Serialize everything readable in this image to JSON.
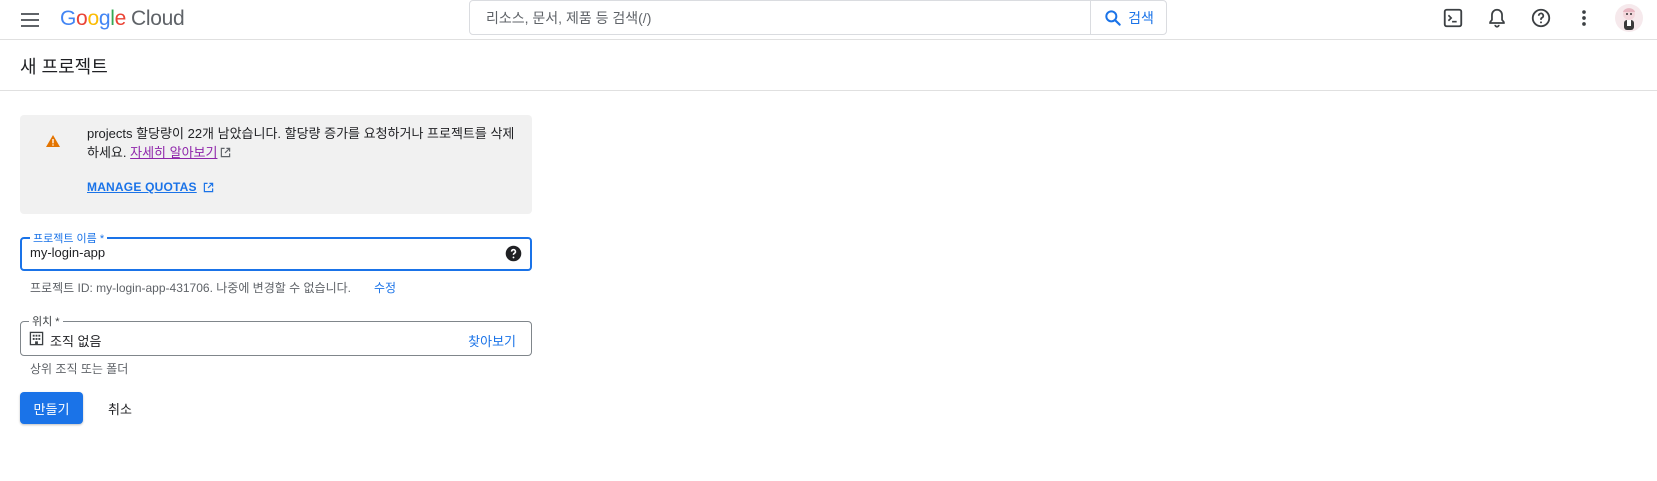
{
  "header": {
    "logo": {
      "G": "G",
      "o1": "o",
      "o2": "o",
      "g": "g",
      "l": "l",
      "e": "e",
      "cloud": "Cloud"
    },
    "search": {
      "placeholder": "리소스, 문서, 제품 등 검색(/)",
      "button_label": "검색"
    },
    "icons": [
      "menu-icon",
      "cloud-shell-icon",
      "notifications-icon",
      "help-icon",
      "more-vert-icon",
      "avatar"
    ]
  },
  "page": {
    "title": "새 프로젝트"
  },
  "warning": {
    "text": "projects 할당량이 22개 남았습니다. 할당량 증가를 요청하거나 프로젝트를 삭제하세요.",
    "learn_more": "자세히 알아보기",
    "manage_quotas": "MANAGE QUOTAS"
  },
  "project_name": {
    "label": "프로젝트 이름 *",
    "value": "my-login-app",
    "hint": "프로젝트 ID: my-login-app-431706. 나중에 변경할 수 없습니다.",
    "edit": "수정"
  },
  "location": {
    "label": "위치 *",
    "value": "조직 없음",
    "browse": "찾아보기",
    "hint": "상위 조직 또는 폴더"
  },
  "actions": {
    "create": "만들기",
    "cancel": "취소"
  },
  "colors": {
    "accent": "#1a73e8",
    "warning": "#e37400",
    "link_visited": "#8e24aa"
  }
}
